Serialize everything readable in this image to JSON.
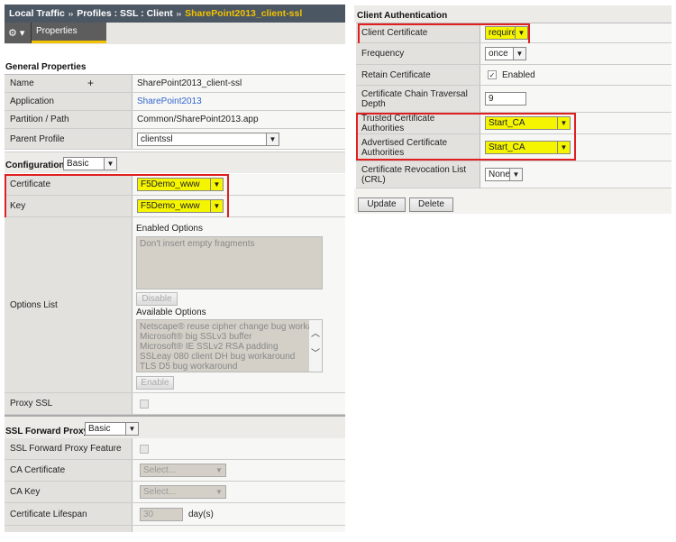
{
  "breadcrumb": {
    "part1": "Local Traffic",
    "part2": "Profiles : SSL : Client",
    "current": "SharePoint2013_client-ssl",
    "sep": "››"
  },
  "tabs": {
    "gear": "⚙ ▾",
    "properties": "Properties"
  },
  "general": {
    "heading": "General Properties",
    "name_label": "Name",
    "name_value": "SharePoint2013_client-ssl",
    "app_label": "Application",
    "app_value": "SharePoint2013",
    "partition_label": "Partition / Path",
    "partition_value": "Common/SharePoint2013.app",
    "parent_label": "Parent Profile",
    "parent_value": "clientssl"
  },
  "configuration": {
    "label": "Configuration:",
    "mode": "Basic",
    "cert_label": "Certificate",
    "cert_value": "F5Demo_www",
    "key_label": "Key",
    "key_value": "F5Demo_www",
    "options_label": "Options List",
    "enabled_heading": "Enabled Options",
    "enabled_options": [
      "Don't insert empty fragments"
    ],
    "disable_btn": "Disable",
    "available_heading": "Available Options",
    "available_options": [
      "Netscape® reuse cipher change bug workaro",
      "Microsoft® big SSLv3 buffer",
      "Microsoft® IE SSLv2 RSA padding",
      "SSLeay 080 client DH bug workaround",
      "TLS D5 bug workaround"
    ],
    "enable_btn": "Enable",
    "proxy_ssl_label": "Proxy SSL"
  },
  "forward_proxy": {
    "label": "SSL Forward Proxy:",
    "mode": "Basic",
    "feature_label": "SSL Forward Proxy Feature",
    "ca_cert_label": "CA Certificate",
    "ca_cert_value": "Select...",
    "ca_key_label": "CA Key",
    "ca_key_value": "Select...",
    "lifespan_label": "Certificate Lifespan",
    "lifespan_value": "30",
    "lifespan_unit": "day(s)"
  },
  "client_auth": {
    "heading": "Client Authentication",
    "client_cert_label": "Client Certificate",
    "client_cert_value": "require",
    "frequency_label": "Frequency",
    "frequency_value": "once",
    "retain_label": "Retain Certificate",
    "retain_value": "Enabled",
    "depth_label": "Certificate Chain Traversal Depth",
    "depth_value": "9",
    "trusted_label": "Trusted Certificate Authorities",
    "trusted_value": "Start_CA",
    "advertised_label": "Advertised Certificate Authorities",
    "advertised_value": "Start_CA",
    "crl_label": "Certificate Revocation List (CRL)",
    "crl_value": "None",
    "update_btn": "Update",
    "delete_btn": "Delete"
  }
}
